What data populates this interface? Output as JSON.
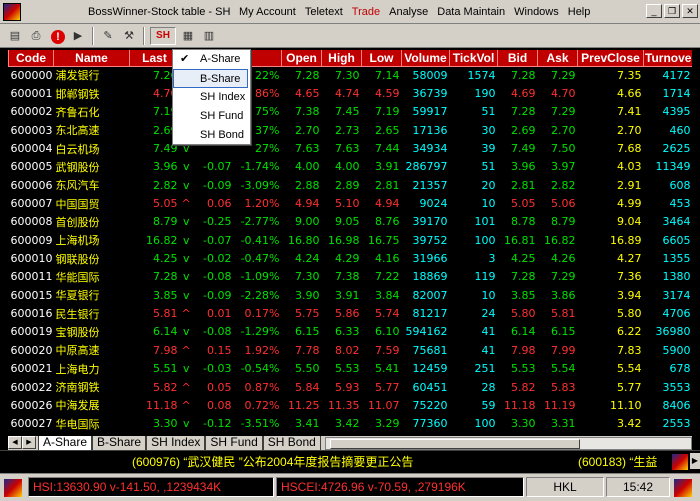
{
  "window": {
    "title": "BossWinner-Stock table - SH"
  },
  "menu": [
    "My Account",
    "Teletext",
    "Trade",
    "Analyse",
    "Data Maintain",
    "Windows",
    "Help"
  ],
  "toolbar": {
    "sh_label": "SH"
  },
  "market_dropdown": {
    "options": [
      "A-Share",
      "B-Share",
      "SH Index",
      "SH Fund",
      "SH Bond"
    ],
    "checked": "A-Share",
    "hovered": "B-Share"
  },
  "table": {
    "columns": [
      "Code",
      "Name",
      "Last",
      "",
      "",
      "",
      "Open",
      "High",
      "Low",
      "Volume",
      "TickVol",
      "Bid",
      "Ask",
      "PrevClose",
      "Turnover"
    ],
    "rows": [
      {
        "code": "600000",
        "name": "浦发银行",
        "last": "7.26",
        "mark": "v",
        "chg": "",
        "pct": "22%",
        "open": "7.28",
        "high": "7.30",
        "low": "7.14",
        "vol": "58009",
        "tick": "1574",
        "bid": "7.28",
        "ask": "7.29",
        "prev": "7.35",
        "turn": "4172",
        "dir": "g"
      },
      {
        "code": "600001",
        "name": "邯郸钢铁",
        "last": "4.70",
        "mark": "^",
        "chg": "",
        "pct": "86%",
        "open": "4.65",
        "high": "4.74",
        "low": "4.59",
        "vol": "36739",
        "tick": "190",
        "bid": "4.69",
        "ask": "4.70",
        "prev": "4.66",
        "turn": "1714",
        "dir": "r"
      },
      {
        "code": "600002",
        "name": "齐鲁石化",
        "last": "7.19",
        "mark": "v",
        "chg": "",
        "pct": "75%",
        "open": "7.38",
        "high": "7.45",
        "low": "7.19",
        "vol": "59917",
        "tick": "51",
        "bid": "7.28",
        "ask": "7.29",
        "prev": "7.41",
        "turn": "4395",
        "dir": "g"
      },
      {
        "code": "600003",
        "name": "东北高速",
        "last": "2.69",
        "mark": "v",
        "chg": "",
        "pct": "37%",
        "open": "2.70",
        "high": "2.73",
        "low": "2.65",
        "vol": "17136",
        "tick": "30",
        "bid": "2.69",
        "ask": "2.70",
        "prev": "2.70",
        "turn": "460",
        "dir": "g"
      },
      {
        "code": "600004",
        "name": "白云机场",
        "last": "7.49",
        "mark": "v",
        "chg": "",
        "pct": "27%",
        "open": "7.63",
        "high": "7.63",
        "low": "7.44",
        "vol": "34934",
        "tick": "39",
        "bid": "7.49",
        "ask": "7.50",
        "prev": "7.68",
        "turn": "2625",
        "dir": "g"
      },
      {
        "code": "600005",
        "name": "武钢股份",
        "last": "3.96",
        "mark": "v",
        "chg": "-0.07",
        "pct": "-1.74%",
        "open": "4.00",
        "high": "4.00",
        "low": "3.91",
        "vol": "286797",
        "tick": "51",
        "bid": "3.96",
        "ask": "3.97",
        "prev": "4.03",
        "turn": "11349",
        "dir": "g"
      },
      {
        "code": "600006",
        "name": "东风汽车",
        "last": "2.82",
        "mark": "v",
        "chg": "-0.09",
        "pct": "-3.09%",
        "open": "2.88",
        "high": "2.89",
        "low": "2.81",
        "vol": "21357",
        "tick": "20",
        "bid": "2.81",
        "ask": "2.82",
        "prev": "2.91",
        "turn": "608",
        "dir": "g"
      },
      {
        "code": "600007",
        "name": "中国国贸",
        "last": "5.05",
        "mark": "^",
        "chg": "0.06",
        "pct": "1.20%",
        "open": "4.94",
        "high": "5.10",
        "low": "4.94",
        "vol": "9024",
        "tick": "10",
        "bid": "5.05",
        "ask": "5.06",
        "prev": "4.99",
        "turn": "453",
        "dir": "r"
      },
      {
        "code": "600008",
        "name": "首创股份",
        "last": "8.79",
        "mark": "v",
        "chg": "-0.25",
        "pct": "-2.77%",
        "open": "9.00",
        "high": "9.05",
        "low": "8.76",
        "vol": "39170",
        "tick": "101",
        "bid": "8.78",
        "ask": "8.79",
        "prev": "9.04",
        "turn": "3464",
        "dir": "g"
      },
      {
        "code": "600009",
        "name": "上海机场",
        "last": "16.82",
        "mark": "v",
        "chg": "-0.07",
        "pct": "-0.41%",
        "open": "16.80",
        "high": "16.98",
        "low": "16.75",
        "vol": "39752",
        "tick": "100",
        "bid": "16.81",
        "ask": "16.82",
        "prev": "16.89",
        "turn": "6605",
        "dir": "g"
      },
      {
        "code": "600010",
        "name": "钢联股份",
        "last": "4.25",
        "mark": "v",
        "chg": "-0.02",
        "pct": "-0.47%",
        "open": "4.24",
        "high": "4.29",
        "low": "4.16",
        "vol": "31966",
        "tick": "3",
        "bid": "4.25",
        "ask": "4.26",
        "prev": "4.27",
        "turn": "1355",
        "dir": "g"
      },
      {
        "code": "600011",
        "name": "华能国际",
        "last": "7.28",
        "mark": "v",
        "chg": "-0.08",
        "pct": "-1.09%",
        "open": "7.30",
        "high": "7.38",
        "low": "7.22",
        "vol": "18869",
        "tick": "119",
        "bid": "7.28",
        "ask": "7.29",
        "prev": "7.36",
        "turn": "1380",
        "dir": "g"
      },
      {
        "code": "600015",
        "name": "华夏银行",
        "last": "3.85",
        "mark": "v",
        "chg": "-0.09",
        "pct": "-2.28%",
        "open": "3.90",
        "high": "3.91",
        "low": "3.84",
        "vol": "82007",
        "tick": "10",
        "bid": "3.85",
        "ask": "3.86",
        "prev": "3.94",
        "turn": "3174",
        "dir": "g"
      },
      {
        "code": "600016",
        "name": "民生银行",
        "last": "5.81",
        "mark": "^",
        "chg": "0.01",
        "pct": "0.17%",
        "open": "5.75",
        "high": "5.86",
        "low": "5.74",
        "vol": "81217",
        "tick": "24",
        "bid": "5.80",
        "ask": "5.81",
        "prev": "5.80",
        "turn": "4706",
        "dir": "r"
      },
      {
        "code": "600019",
        "name": "宝钢股份",
        "last": "6.14",
        "mark": "v",
        "chg": "-0.08",
        "pct": "-1.29%",
        "open": "6.15",
        "high": "6.33",
        "low": "6.10",
        "vol": "594162",
        "tick": "41",
        "bid": "6.14",
        "ask": "6.15",
        "prev": "6.22",
        "turn": "36980",
        "dir": "g"
      },
      {
        "code": "600020",
        "name": "中原高速",
        "last": "7.98",
        "mark": "^",
        "chg": "0.15",
        "pct": "1.92%",
        "open": "7.78",
        "high": "8.02",
        "low": "7.59",
        "vol": "75681",
        "tick": "41",
        "bid": "7.98",
        "ask": "7.99",
        "prev": "7.83",
        "turn": "5900",
        "dir": "r"
      },
      {
        "code": "600021",
        "name": "上海电力",
        "last": "5.51",
        "mark": "v",
        "chg": "-0.03",
        "pct": "-0.54%",
        "open": "5.50",
        "high": "5.53",
        "low": "5.41",
        "vol": "12459",
        "tick": "251",
        "bid": "5.53",
        "ask": "5.54",
        "prev": "5.54",
        "turn": "678",
        "dir": "g"
      },
      {
        "code": "600022",
        "name": "济南钢铁",
        "last": "5.82",
        "mark": "^",
        "chg": "0.05",
        "pct": "0.87%",
        "open": "5.84",
        "high": "5.93",
        "low": "5.77",
        "vol": "60451",
        "tick": "28",
        "bid": "5.82",
        "ask": "5.83",
        "prev": "5.77",
        "turn": "3553",
        "dir": "r"
      },
      {
        "code": "600026",
        "name": "中海发展",
        "last": "11.18",
        "mark": "^",
        "chg": "0.08",
        "pct": "0.72%",
        "open": "11.25",
        "high": "11.35",
        "low": "11.07",
        "vol": "75220",
        "tick": "59",
        "bid": "11.18",
        "ask": "11.19",
        "prev": "11.10",
        "turn": "8406",
        "dir": "r"
      },
      {
        "code": "600027",
        "name": "华电国际",
        "last": "3.30",
        "mark": "v",
        "chg": "-0.12",
        "pct": "-3.51%",
        "open": "3.41",
        "high": "3.42",
        "low": "3.29",
        "vol": "77360",
        "tick": "100",
        "bid": "3.30",
        "ask": "3.31",
        "prev": "3.42",
        "turn": "2553",
        "dir": "g"
      }
    ]
  },
  "tabs": [
    "A-Share",
    "B-Share",
    "SH Index",
    "SH Fund",
    "SH Bond"
  ],
  "active_tab": "A-Share",
  "ticker": {
    "left": "(600976) “武汉健民 ”公布2004年度报告摘要更正公告",
    "right": "(600183) “生益"
  },
  "status": {
    "hsi": "HSI:13630.90 v-141.50, ,1239434K",
    "hscei": "HSCEI:4726.96 v-70.59, ,279196K",
    "hkl": "HKL",
    "time": "15:42"
  },
  "colors": {
    "header_bg": "#c00000",
    "down": "#00e000",
    "up": "#ff3030",
    "name": "#ffff00",
    "tickvol": "#00ffff"
  }
}
